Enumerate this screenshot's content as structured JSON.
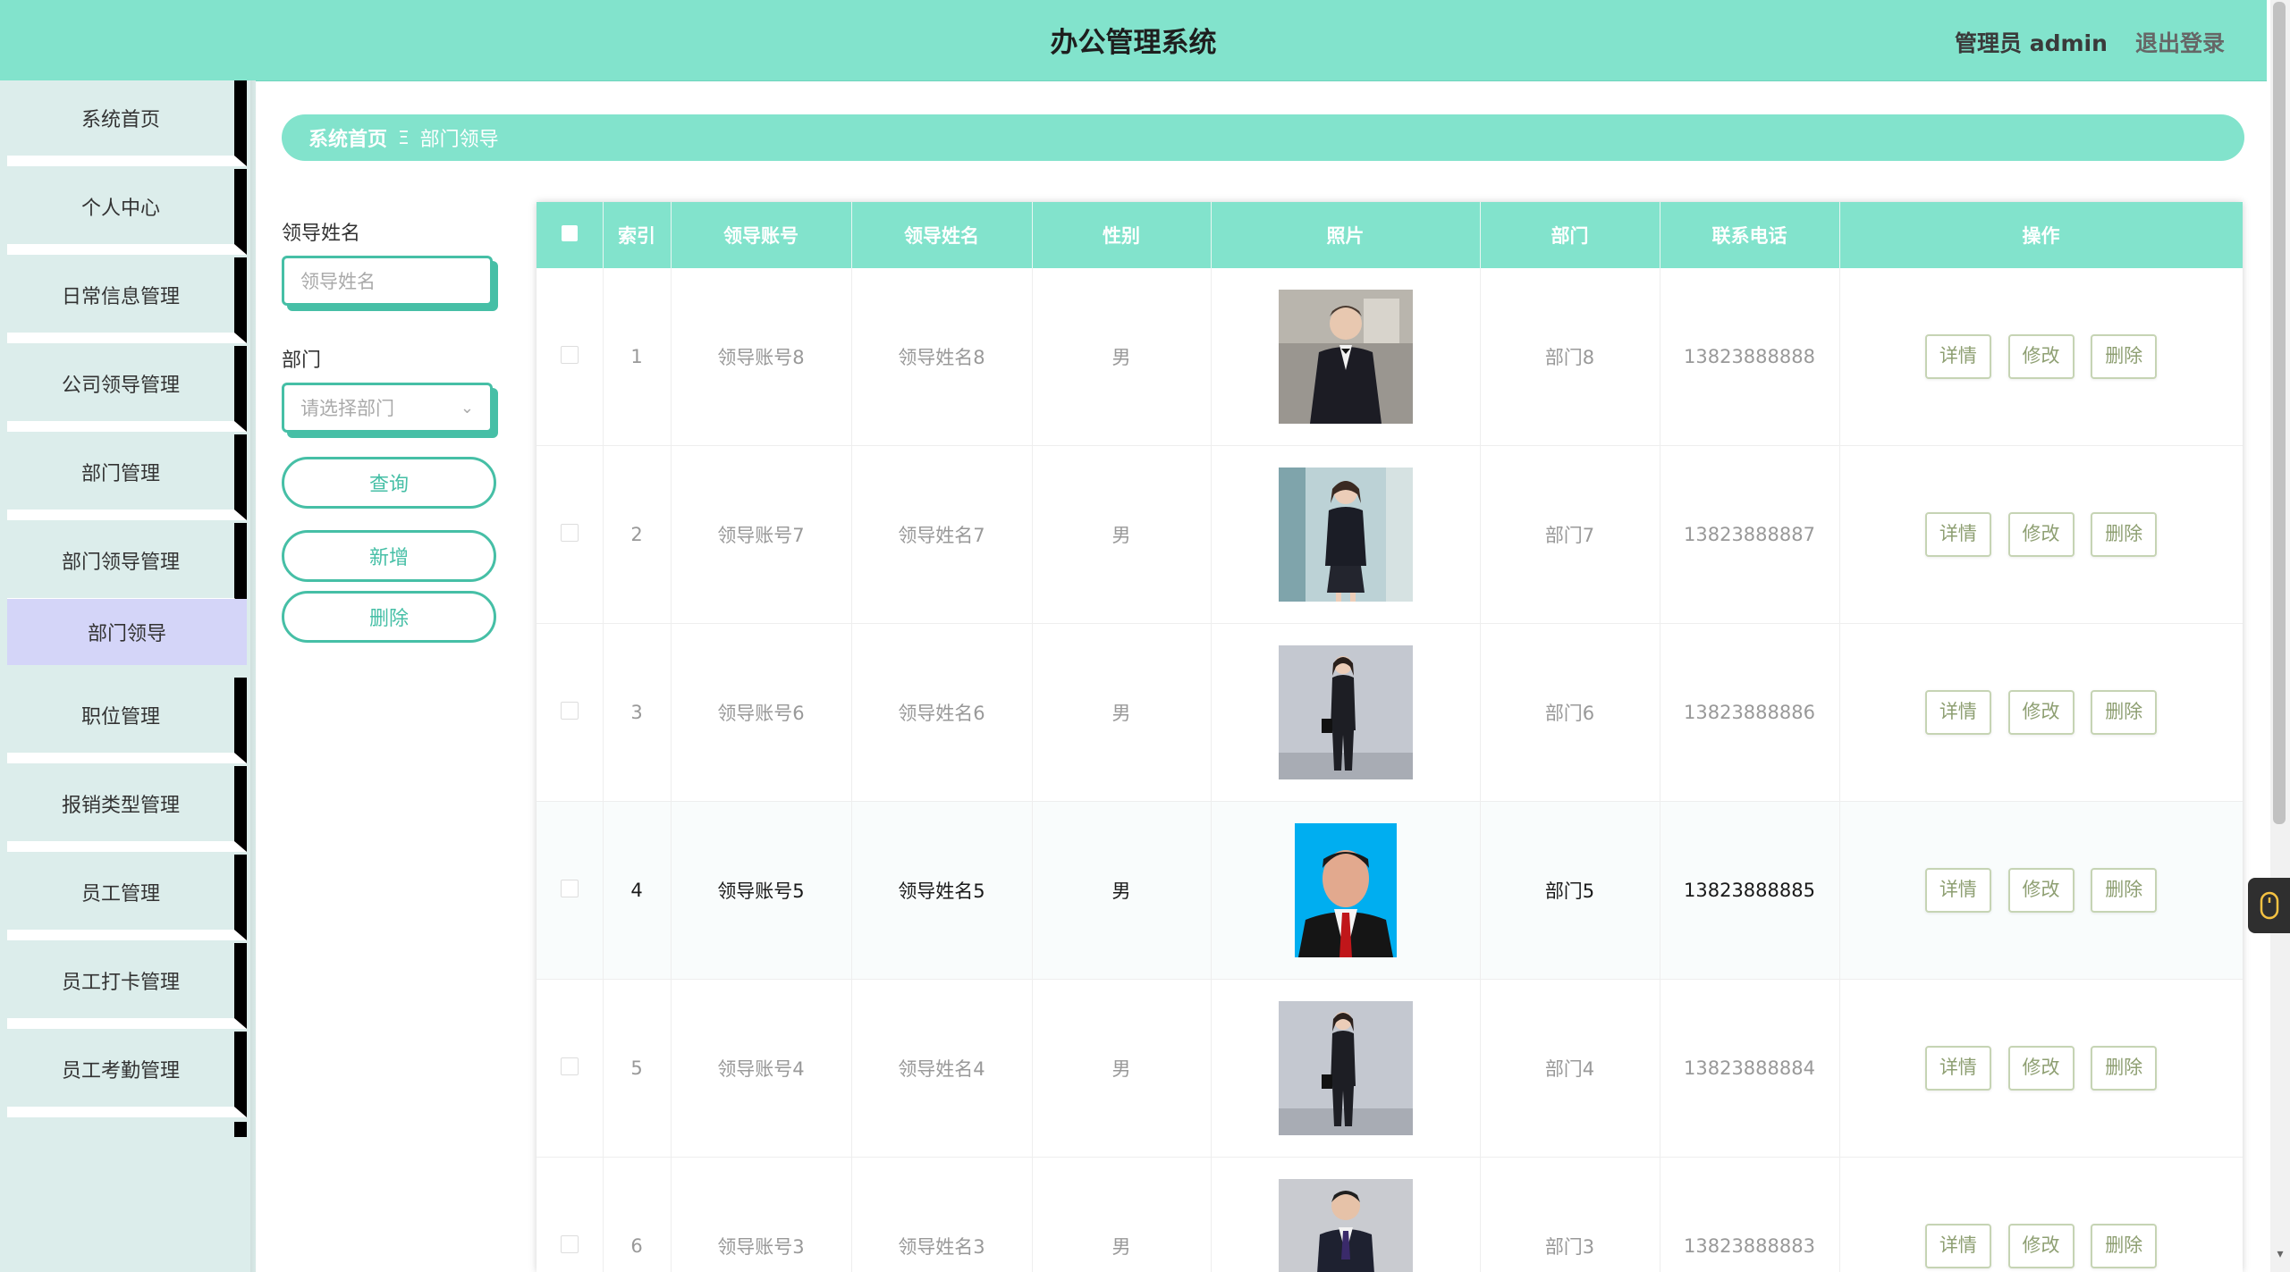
{
  "header": {
    "title": "办公管理系统",
    "user": "管理员 admin",
    "logout": "退出登录"
  },
  "sidebar": {
    "items": [
      "系统首页",
      "个人中心",
      "日常信息管理",
      "公司领导管理",
      "部门管理",
      "部门领导管理"
    ],
    "active_sub": "部门领导",
    "items_after": [
      "职位管理",
      "报销类型管理",
      "员工管理",
      "员工打卡管理",
      "员工考勤管理"
    ]
  },
  "breadcrumb": {
    "home": "系统首页",
    "separator": "Ξ",
    "current": "部门领导"
  },
  "search": {
    "name_label": "领导姓名",
    "name_placeholder": "领导姓名",
    "dept_label": "部门",
    "dept_placeholder": "请选择部门",
    "query": "查询",
    "add": "新增",
    "delete": "删除"
  },
  "table": {
    "columns": [
      "索引",
      "领导账号",
      "领导姓名",
      "性别",
      "照片",
      "部门",
      "联系电话",
      "操作"
    ],
    "rows": [
      {
        "index": "1",
        "account": "领导账号8",
        "name": "领导姓名8",
        "gender": "男",
        "dept": "部门8",
        "phone": "13823888888",
        "photo": "man-suit"
      },
      {
        "index": "2",
        "account": "领导账号7",
        "name": "领导姓名7",
        "gender": "男",
        "dept": "部门7",
        "phone": "13823888887",
        "photo": "woman-suit"
      },
      {
        "index": "3",
        "account": "领导账号6",
        "name": "领导姓名6",
        "gender": "男",
        "dept": "部门6",
        "phone": "13823888886",
        "photo": "woman-standing"
      },
      {
        "index": "4",
        "account": "领导账号5",
        "name": "领导姓名5",
        "gender": "男",
        "dept": "部门5",
        "phone": "13823888885",
        "photo": "man-id"
      },
      {
        "index": "5",
        "account": "领导账号4",
        "name": "领导姓名4",
        "gender": "男",
        "dept": "部门4",
        "phone": "13823888884",
        "photo": "woman-standing"
      },
      {
        "index": "6",
        "account": "领导账号3",
        "name": "领导姓名3",
        "gender": "男",
        "dept": "部门3",
        "phone": "13823888883",
        "photo": "man-business"
      }
    ],
    "actions": {
      "detail": "详情",
      "edit": "修改",
      "delete": "删除"
    }
  },
  "colors": {
    "accent": "#82e3cc",
    "accent_dark": "#46bfa6",
    "sidebar_bg": "#dcedeb",
    "active_item": "#d4d5f8"
  }
}
